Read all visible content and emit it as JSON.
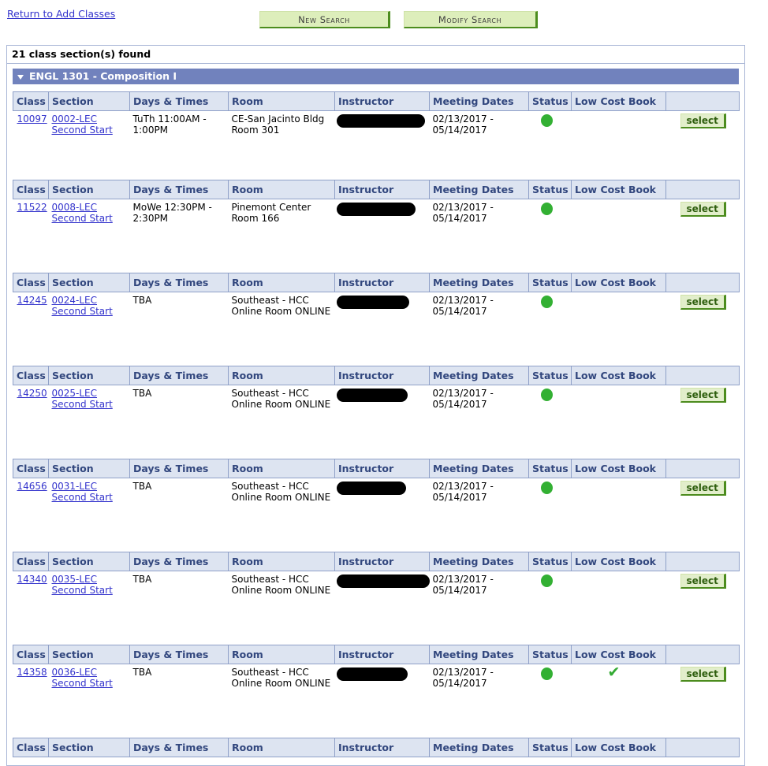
{
  "topbar": {
    "return_link": "Return to Add Classes",
    "new_search_label": "New Search",
    "modify_search_label": "Modify Search"
  },
  "results": {
    "found_text": "21 class section(s) found",
    "course_title": "ENGL 1301 - Composition I",
    "collapse_icon": "triangle-down-icon"
  },
  "columns": [
    "Class",
    "Section",
    "Days & Times",
    "Room",
    "Instructor",
    "Meeting Dates",
    "Status",
    "Low Cost Book",
    ""
  ],
  "status_colors": {
    "open": "#33b033",
    "low_cost_check": "#33aa33",
    "course_bar": "#7182bd",
    "header_cell": "#dde4f1",
    "button_green": "#ddeebb",
    "link_blue": "#3333cc"
  },
  "select_label": "select",
  "sections": [
    {
      "class": "10097",
      "section": "0002-LEC",
      "section_sub": "Second Start",
      "days_times": "TuTh 11:00AM - 1:00PM",
      "room": "CE-San Jacinto Bldg Room 301",
      "instructor": "",
      "instructor_redacted_width": 112,
      "meeting_dates": "02/13/2017 - 05/14/2017",
      "status": "open",
      "low_cost_book": false,
      "action": "select"
    },
    {
      "class": "11522",
      "section": "0008-LEC",
      "section_sub": "Second Start",
      "days_times": "MoWe 12:30PM - 2:30PM",
      "room": "Pinemont Center Room 166",
      "instructor": "",
      "instructor_redacted_width": 100,
      "meeting_dates": "02/13/2017 - 05/14/2017",
      "status": "open",
      "low_cost_book": false,
      "action": "select"
    },
    {
      "class": "14245",
      "section": "0024-LEC",
      "section_sub": "Second Start",
      "days_times": "TBA",
      "room": "Southeast - HCC Online Room ONLINE",
      "instructor": "",
      "instructor_redacted_width": 92,
      "meeting_dates": "02/13/2017 - 05/14/2017",
      "status": "open",
      "low_cost_book": false,
      "action": "select"
    },
    {
      "class": "14250",
      "section": "0025-LEC",
      "section_sub": "Second Start",
      "days_times": "TBA",
      "room": "Southeast - HCC Online Room ONLINE",
      "instructor": "",
      "instructor_redacted_width": 90,
      "meeting_dates": "02/13/2017 - 05/14/2017",
      "status": "open",
      "low_cost_book": false,
      "action": "select"
    },
    {
      "class": "14656",
      "section": "0031-LEC",
      "section_sub": "Second Start",
      "days_times": "TBA",
      "room": "Southeast - HCC Online Room ONLINE",
      "instructor": "",
      "instructor_redacted_width": 88,
      "meeting_dates": "02/13/2017 - 05/14/2017",
      "status": "open",
      "low_cost_book": false,
      "action": "select"
    },
    {
      "class": "14340",
      "section": "0035-LEC",
      "section_sub": "Second Start",
      "days_times": "TBA",
      "room": "Southeast - HCC Online Room ONLINE",
      "instructor": "",
      "instructor_redacted_width": 118,
      "meeting_dates": "02/13/2017 - 05/14/2017",
      "status": "open",
      "low_cost_book": false,
      "action": "select"
    },
    {
      "class": "14358",
      "section": "0036-LEC",
      "section_sub": "Second Start",
      "days_times": "TBA",
      "room": "Southeast - HCC Online Room ONLINE",
      "instructor": "",
      "instructor_redacted_width": 90,
      "meeting_dates": "02/13/2017 - 05/14/2017",
      "status": "open",
      "low_cost_book": true,
      "action": "select"
    }
  ]
}
